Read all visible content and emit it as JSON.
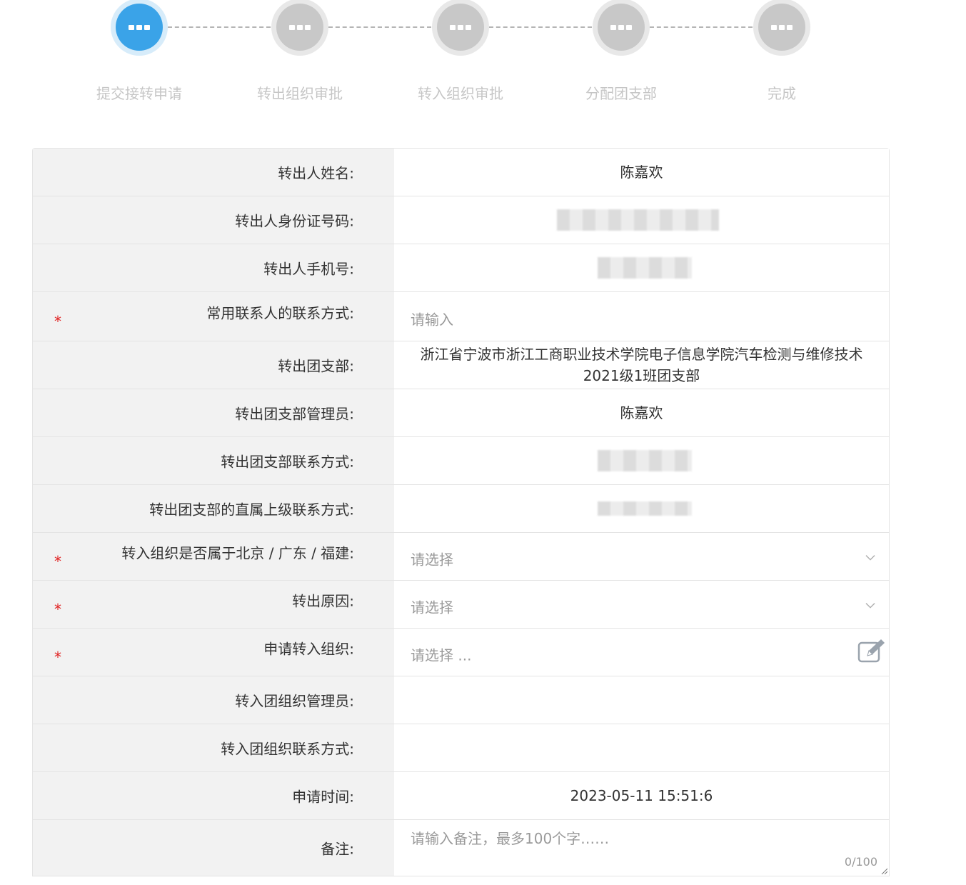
{
  "steps": [
    {
      "label": "提交接转申请",
      "active": true
    },
    {
      "label": "转出组织审批",
      "active": false
    },
    {
      "label": "转入组织审批",
      "active": false
    },
    {
      "label": "分配团支部",
      "active": false
    },
    {
      "label": "完成",
      "active": false
    }
  ],
  "colors": {
    "active_step": "#3aa3e8",
    "inactive_step": "#c8c8c8",
    "required_mark": "#e02020",
    "label_bg": "#f2f2f2"
  },
  "form": {
    "required_mark": "*",
    "name": {
      "label": "转出人姓名:",
      "value": "陈嘉欢"
    },
    "id_number": {
      "label": "转出人身份证号码:"
    },
    "phone": {
      "label": "转出人手机号:"
    },
    "contact": {
      "label": "常用联系人的联系方式:",
      "placeholder": "请输入"
    },
    "branch": {
      "label": "转出团支部:",
      "value": "浙江省宁波市浙江工商职业技术学院电子信息学院汽车检测与维修技术 2021级1班团支部"
    },
    "branch_admin": {
      "label": "转出团支部管理员:",
      "value": "陈嘉欢"
    },
    "branch_contact": {
      "label": "转出团支部联系方式:"
    },
    "superior_contact": {
      "label": "转出团支部的直属上级联系方式:"
    },
    "region": {
      "label": "转入组织是否属于北京 / 广东 / 福建:",
      "placeholder": "请选择"
    },
    "reason": {
      "label": "转出原因:",
      "placeholder": "请选择"
    },
    "target_org": {
      "label": "申请转入组织:",
      "placeholder": "请选择 ..."
    },
    "target_admin": {
      "label": "转入团组织管理员:"
    },
    "target_contact": {
      "label": "转入团组织联系方式:"
    },
    "apply_time": {
      "label": "申请时间:",
      "value": "2023-05-11 15:51:6"
    },
    "remark": {
      "label": "备注:",
      "placeholder": "请输入备注，最多100个字……",
      "counter": "0/100"
    }
  }
}
